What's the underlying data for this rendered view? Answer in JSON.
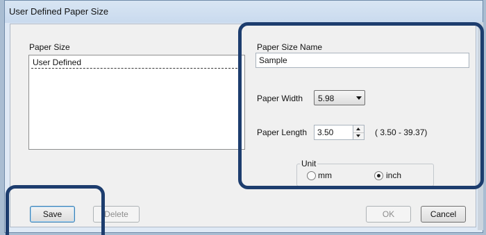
{
  "window": {
    "title": "User Defined Paper Size"
  },
  "paper_size_list": {
    "label": "Paper Size",
    "items": [
      "User Defined"
    ]
  },
  "paper_size_name": {
    "label": "Paper Size Name",
    "value": "Sample"
  },
  "paper_width": {
    "label": "Paper Width",
    "selected": "5.98"
  },
  "paper_length": {
    "label": "Paper Length",
    "value": "3.50",
    "range": "( 3.50 - 39.37)"
  },
  "unit": {
    "label": "Unit",
    "options": [
      {
        "label": "mm",
        "checked": false
      },
      {
        "label": "inch",
        "checked": true
      }
    ]
  },
  "buttons": {
    "save": "Save",
    "delete": "Delete",
    "ok": "OK",
    "cancel": "Cancel"
  },
  "colors": {
    "callout": "#1d3d6e",
    "dialog_bg": "#f0f0f0",
    "title_bg": "#c9daee"
  }
}
